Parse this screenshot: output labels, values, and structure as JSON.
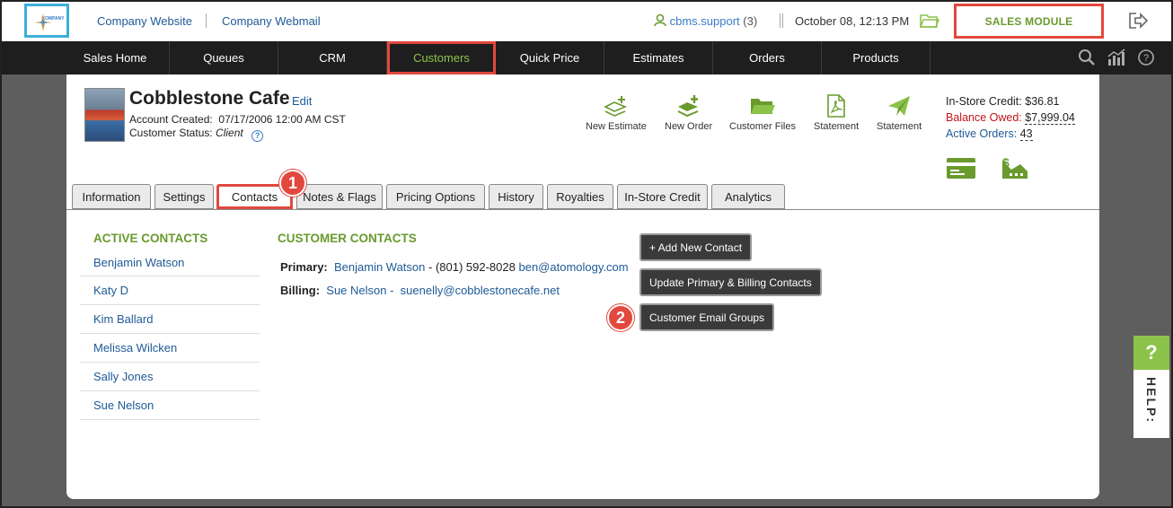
{
  "topbar": {
    "logo_text": "COMPANY",
    "company_website": "Company Website",
    "company_webmail": "Company Webmail",
    "user": "cbms.support",
    "user_count": "(3)",
    "datetime": "October 08, 12:13 PM",
    "sales_module": "SALES MODULE"
  },
  "nav": {
    "items": [
      "Sales Home",
      "Queues",
      "CRM",
      "Customers",
      "Quick Price",
      "Estimates",
      "Orders",
      "Products"
    ],
    "active": "Customers"
  },
  "customer": {
    "name": "Cobblestone Cafe",
    "edit": "Edit",
    "account_created_label": "Account Created:",
    "account_created": "07/17/2006 12:00 AM CST",
    "status_label": "Customer Status:",
    "status": "Client"
  },
  "actions": [
    "New Estimate",
    "New Order",
    "Customer Files",
    "Statement",
    "Statement"
  ],
  "credit": {
    "instore_label": "In-Store Credit:",
    "instore": "$36.81",
    "balance_label": "Balance Owed:",
    "balance": "$7,999.04",
    "active_label": "Active Orders:",
    "active": "43"
  },
  "tabs": [
    "Information",
    "Settings",
    "Contacts",
    "Notes & Flags",
    "Pricing Options",
    "History",
    "Royalties",
    "In-Store Credit",
    "Analytics"
  ],
  "active_tab": "Contacts",
  "badges": [
    "1",
    "2"
  ],
  "active_contacts": {
    "title": "ACTIVE CONTACTS",
    "items": [
      "Benjamin Watson",
      "Katy D",
      "Kim Ballard",
      "Melissa Wilcken",
      "Sally Jones",
      "Sue Nelson"
    ]
  },
  "customer_contacts": {
    "title": "CUSTOMER CONTACTS",
    "primary_label": "Primary:",
    "primary_name": "Benjamin Watson",
    "primary_phone": "- (801) 592-8028",
    "primary_email": "ben@atomology.com",
    "billing_label": "Billing:",
    "billing_name": "Sue Nelson -",
    "billing_email": "suenelly@cobblestonecafe.net"
  },
  "buttons": {
    "add_contact": "+ Add New Contact",
    "update_contacts": "Update Primary & Billing Contacts",
    "email_groups": "Customer Email Groups"
  },
  "help": {
    "q": "?",
    "label": "HELP:"
  },
  "colors": {
    "accent_green": "#6a9a2e",
    "highlight_red": "#e2483e",
    "nav_bg": "#1e1e1e",
    "link_blue": "#1f5a96"
  }
}
